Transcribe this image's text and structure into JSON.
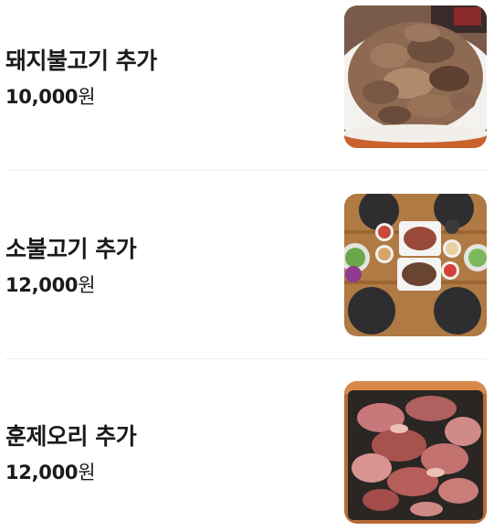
{
  "menu": {
    "items": [
      {
        "name": "돼지불고기 추가",
        "price_number": "10,000",
        "price_unit": "원",
        "image_icon": "pork-bulgogi-photo"
      },
      {
        "name": "소불고기 추가",
        "price_number": "12,000",
        "price_unit": "원",
        "image_icon": "beef-bulgogi-table-photo"
      },
      {
        "name": "훈제오리 추가",
        "price_number": "12,000",
        "price_unit": "원",
        "image_icon": "smoked-duck-photo"
      }
    ]
  }
}
